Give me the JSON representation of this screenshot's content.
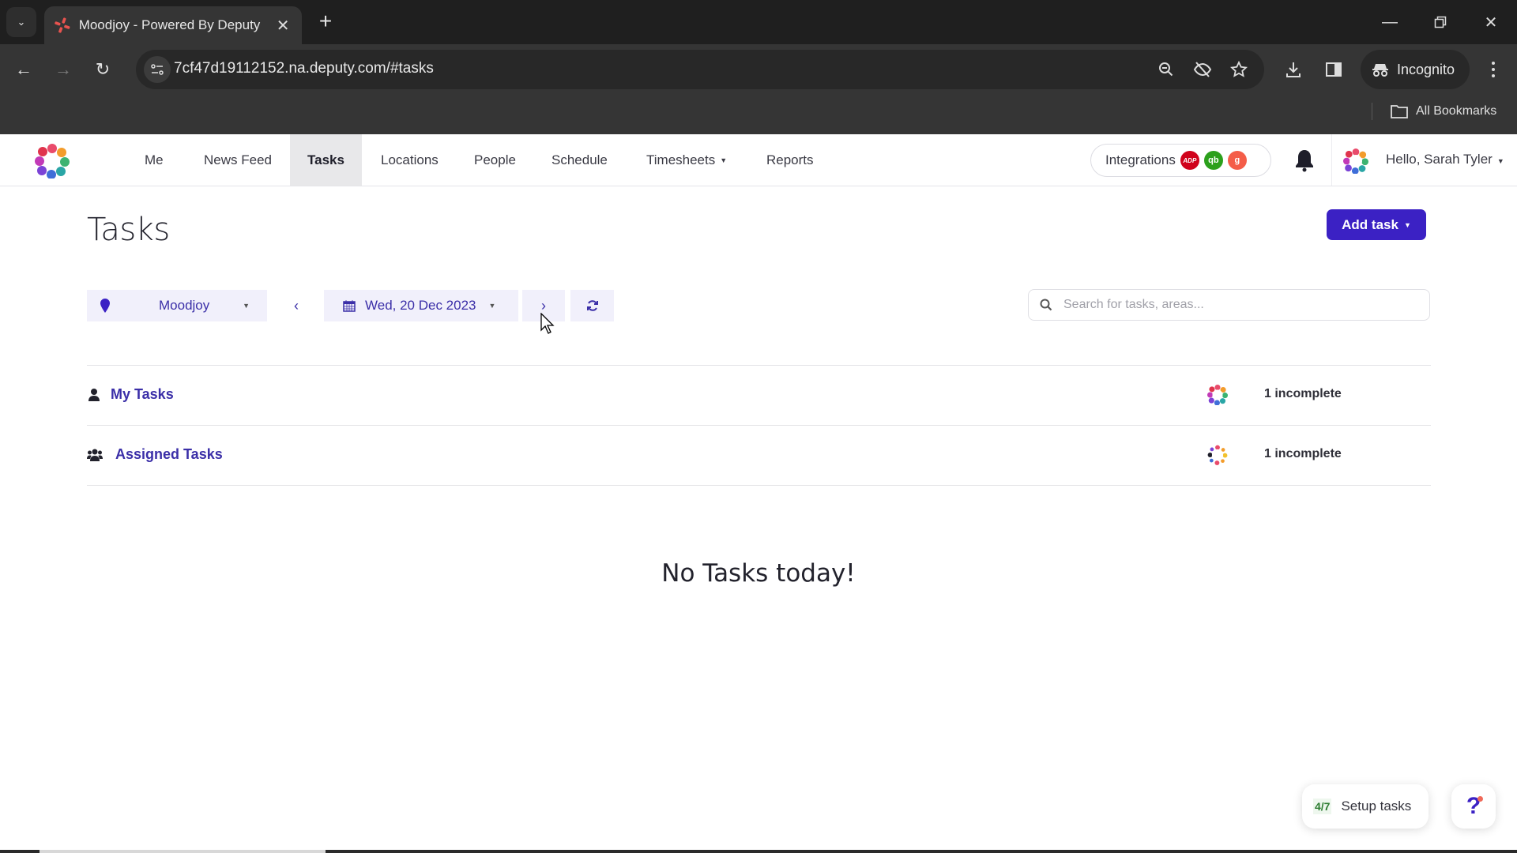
{
  "browser": {
    "tab_title": "Moodjoy - Powered By Deputy",
    "url": "7cf47d19112152.na.deputy.com/#tasks",
    "incognito_label": "Incognito",
    "bookmarks_label": "All Bookmarks",
    "icons": [
      "tab-list-chevron-icon",
      "deputy-favicon-icon",
      "close-icon",
      "plus-icon",
      "minimize-icon",
      "restore-icon",
      "window-close-icon",
      "back-icon",
      "forward-icon",
      "reload-icon",
      "site-settings-icon",
      "zoom-out-icon",
      "eye-off-icon",
      "star-icon",
      "download-icon",
      "side-panel-icon",
      "incognito-icon",
      "more-vert-icon",
      "folder-icon"
    ]
  },
  "nav": {
    "items": [
      {
        "label": "Me",
        "active": false,
        "has_caret": false
      },
      {
        "label": "News Feed",
        "active": false,
        "has_caret": false
      },
      {
        "label": "Tasks",
        "active": true,
        "has_caret": false
      },
      {
        "label": "Locations",
        "active": false,
        "has_caret": false
      },
      {
        "label": "People",
        "active": false,
        "has_caret": false
      },
      {
        "label": "Schedule",
        "active": false,
        "has_caret": false
      },
      {
        "label": "Timesheets",
        "active": false,
        "has_caret": true
      },
      {
        "label": "Reports",
        "active": false,
        "has_caret": false
      }
    ],
    "integrations_label": "Integrations",
    "integration_badges": [
      {
        "name": "adp",
        "text": "ADP",
        "color": "#d0021b"
      },
      {
        "name": "quickbooks",
        "text": "qb",
        "color": "#2ca01c"
      },
      {
        "name": "gusto",
        "text": "g",
        "color": "#f45d48"
      }
    ],
    "user_greeting": "Hello, Sarah Tyler"
  },
  "page": {
    "title": "Tasks",
    "add_task_label": "Add task",
    "location_select": "Moodjoy",
    "date_select": "Wed, 20 Dec 2023",
    "search_placeholder": "Search for tasks, areas...",
    "search_value": "",
    "groups": [
      {
        "label": "My Tasks",
        "icon": "user-icon",
        "status": "1 incomplete"
      },
      {
        "label": "Assigned Tasks",
        "icon": "users-icon",
        "status": "1 incomplete"
      }
    ],
    "empty_message": "No Tasks today!"
  },
  "footer": {
    "setup_count": "4/7",
    "setup_label": "Setup tasks",
    "help_label": "?"
  },
  "colors": {
    "accent": "#3b21c4",
    "link": "#3b2fa8",
    "control_bg": "#f1f0fb",
    "active_nav_bg": "#e8e8ea"
  }
}
